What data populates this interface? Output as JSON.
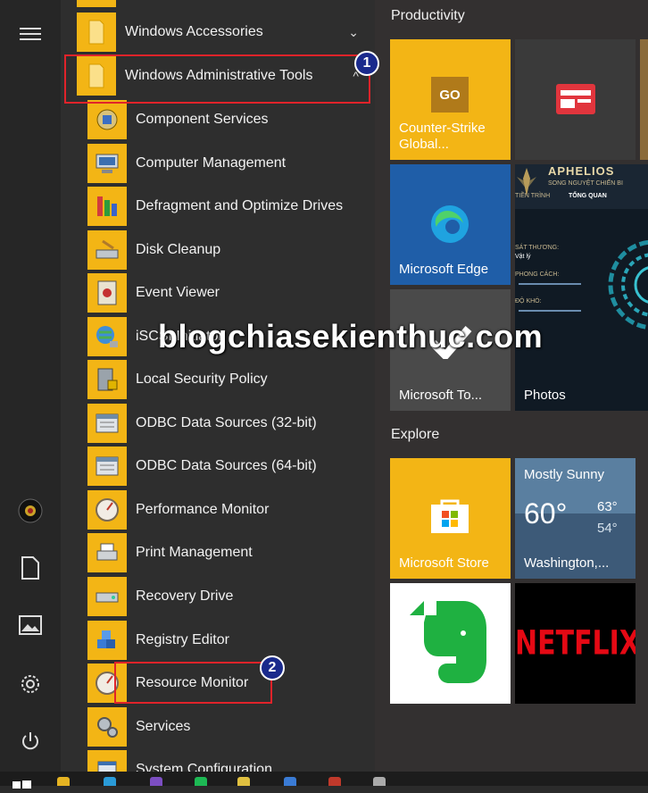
{
  "folders": [
    {
      "label": "Windows Accessories",
      "chevron": "⌄"
    },
    {
      "label": "Windows Administrative Tools",
      "chevron": "^"
    }
  ],
  "apps": [
    "Component Services",
    "Computer Management",
    "Defragment and Optimize Drives",
    "Disk Cleanup",
    "Event Viewer",
    "iSCSI Initiator",
    "Local Security Policy",
    "ODBC Data Sources (32-bit)",
    "ODBC Data Sources (64-bit)",
    "Performance Monitor",
    "Print Management",
    "Recovery Drive",
    "Registry Editor",
    "Resource Monitor",
    "Services",
    "System Configuration"
  ],
  "callouts": {
    "first": "1",
    "second": "2"
  },
  "groups": {
    "productivity": "Productivity",
    "explore": "Explore"
  },
  "tiles": {
    "counter_strike": "Counter-Strike Global...",
    "cs_logo": "GO",
    "edge": "Microsoft Edge",
    "todo": "Microsoft To...",
    "photos": "Photos",
    "store": "Microsoft Store",
    "netflix": "NETFLIX",
    "weather": {
      "condition": "Mostly Sunny",
      "temp": "60°",
      "high": "63°",
      "low": "54°",
      "city": "Washington,..."
    }
  },
  "aphelios": {
    "name": "APHELIOS",
    "subtitle": "SONG NGUYỆT CHIẾN BI",
    "tab1": "TIỀN TRÌNH",
    "tab2": "TỔNG QUAN",
    "stat1": "SÁT THƯƠNG:",
    "stat1_val": "Vật lý",
    "stat2": "PHONG CÁCH:",
    "stat3": "ĐỘ KHÓ:"
  },
  "watermark": "blogchiasekienthuc.com",
  "colors": {
    "accent": "#f3b515",
    "highlight": "#e0232a",
    "badge": "#1a2a8c"
  }
}
